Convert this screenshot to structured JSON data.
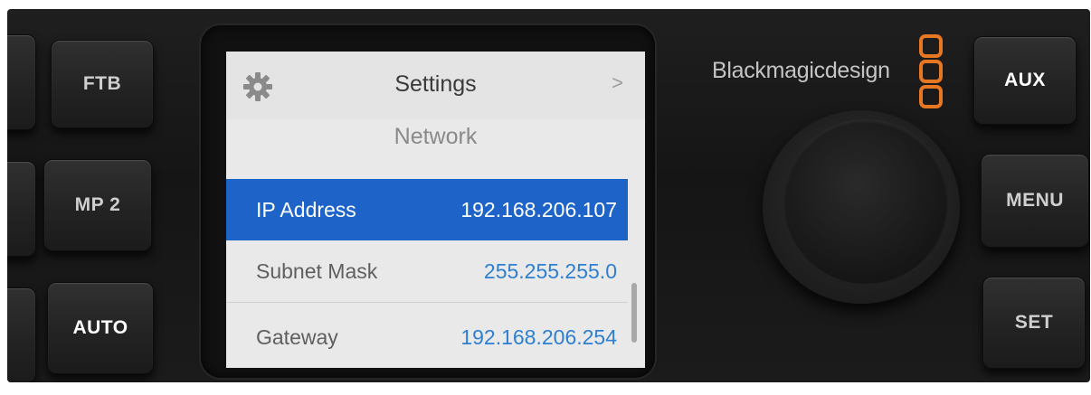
{
  "device": {
    "brand": "Blackmagicdesign",
    "colors": {
      "brand_orange": "#e87722",
      "selection_blue": "#1e64c8",
      "value_blue": "#2f7fd0"
    }
  },
  "left_buttons": [
    {
      "label": "FTB",
      "icon": ""
    },
    {
      "label": "MP 2",
      "icon": ""
    },
    {
      "label": "AUTO",
      "icon": ""
    }
  ],
  "right_buttons": [
    {
      "label": "AUX"
    },
    {
      "label": "MENU"
    },
    {
      "label": "SET"
    }
  ],
  "screen": {
    "header": {
      "title": "Settings",
      "left_icon": "gear-icon",
      "right_icon": "chevron-right-icon",
      "chevron_glyph": ">"
    },
    "section_title": "Network",
    "rows": [
      {
        "label": "IP Address",
        "value": "192.168.206.107",
        "selected": true
      },
      {
        "label": "Subnet Mask",
        "value": "255.255.255.0",
        "selected": false
      },
      {
        "label": "Gateway",
        "value": "192.168.206.254",
        "selected": false
      }
    ],
    "scroll_position": 0.6
  }
}
